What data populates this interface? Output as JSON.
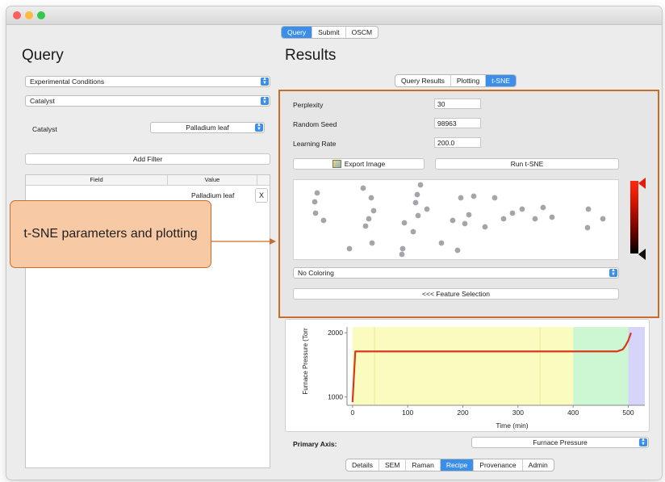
{
  "top_tabs": {
    "items": [
      "Query",
      "Submit",
      "OSCM"
    ],
    "active": 0
  },
  "query": {
    "title": "Query",
    "condition_select": "Experimental Conditions",
    "category_select": "Catalyst",
    "filter_label": "Catalyst",
    "filter_value": "Palladium leaf",
    "add_filter": "Add Filter",
    "table": {
      "col_field": "Field",
      "col_value": "Value",
      "row_value": "Palladium leaf",
      "remove": "X"
    }
  },
  "results": {
    "title": "Results",
    "tabs": {
      "items": [
        "Query Results",
        "Plotting",
        "t-SNE"
      ],
      "active": 2
    },
    "tsne": {
      "perplexity_label": "Perplexity",
      "perplexity": "30",
      "seed_label": "Random Seed",
      "seed": "98963",
      "lr_label": "Learning Rate",
      "lr": "200.0",
      "export": "Export Image",
      "run": "Run t-SNE",
      "coloring": "No Coloring",
      "feature": "<<< Feature Selection",
      "points": [
        [
          392,
          238
        ],
        [
          389,
          249
        ],
        [
          390,
          263
        ],
        [
          400,
          272
        ],
        [
          449,
          232
        ],
        [
          459,
          244
        ],
        [
          462,
          260
        ],
        [
          456,
          270
        ],
        [
          452,
          279
        ],
        [
          520,
          228
        ],
        [
          516,
          240
        ],
        [
          514,
          250
        ],
        [
          517,
          266
        ],
        [
          528,
          258
        ],
        [
          500,
          275
        ],
        [
          511,
          286
        ],
        [
          570,
          244
        ],
        [
          586,
          242
        ],
        [
          580,
          265
        ],
        [
          560,
          272
        ],
        [
          575,
          276
        ],
        [
          612,
          244
        ],
        [
          600,
          280
        ],
        [
          623,
          270
        ],
        [
          634,
          263
        ],
        [
          646,
          258
        ],
        [
          672,
          256
        ],
        [
          683,
          268
        ],
        [
          662,
          270
        ],
        [
          728,
          258
        ],
        [
          746,
          270
        ],
        [
          727,
          281
        ],
        [
          432,
          307
        ],
        [
          460,
          300
        ],
        [
          498,
          307
        ],
        [
          497,
          314
        ],
        [
          546,
          300
        ],
        [
          566,
          309
        ]
      ]
    }
  },
  "chart_data": {
    "type": "line",
    "title": "",
    "xlabel": "Time (min)",
    "ylabel": "Furnace Pressure (Torr",
    "xlim": [
      -10,
      530
    ],
    "ylim": [
      870,
      2090
    ],
    "xticks": [
      0,
      100,
      200,
      300,
      400,
      500
    ],
    "yticks": [
      1000,
      2000
    ],
    "regions": [
      {
        "from": 0,
        "to": 400,
        "color": "#fafbbe"
      },
      {
        "from": 400,
        "to": 500,
        "color": "#cdf7d2"
      },
      {
        "from": 500,
        "to": 530,
        "color": "#d6d4f8"
      }
    ],
    "series": [
      {
        "color": "#d93a1f",
        "x": [
          0,
          5,
          460,
          480,
          490,
          495,
          500,
          505
        ],
        "y": [
          920,
          1710,
          1710,
          1710,
          1740,
          1800,
          1880,
          2000
        ]
      }
    ]
  },
  "primary_axis": {
    "label": "Primary Axis:",
    "value": "Furnace Pressure"
  },
  "bottom_tabs": {
    "items": [
      "Details",
      "SEM",
      "Raman",
      "Recipe",
      "Provenance",
      "Admin"
    ],
    "active": 3
  },
  "annotation": {
    "text": "t-SNE parameters and plotting",
    "color": "#c96d2a"
  }
}
